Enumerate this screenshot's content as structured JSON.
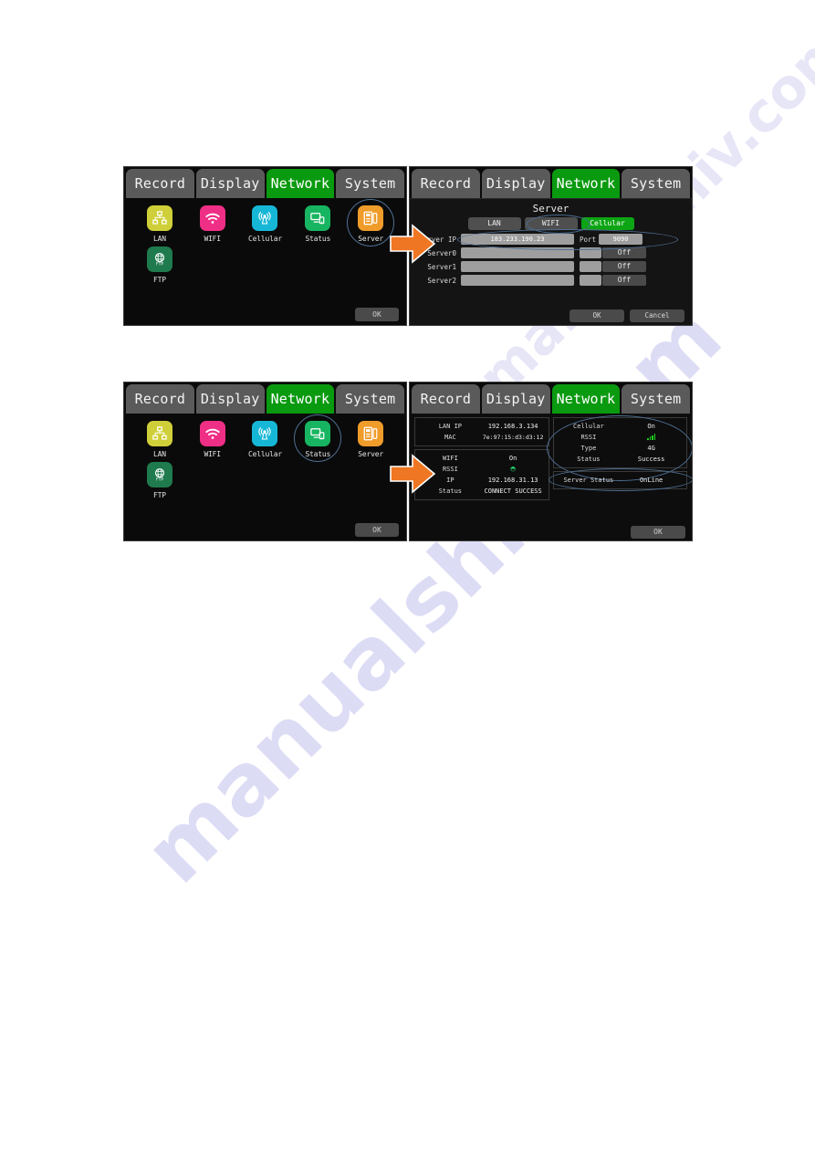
{
  "watermark": {
    "line1": "manualshiv",
    "line2": "manualshiv.com"
  },
  "tabs": [
    {
      "label": "Record",
      "active": false
    },
    {
      "label": "Display",
      "active": false
    },
    {
      "label": "Network",
      "active": true
    },
    {
      "label": "System",
      "active": false
    }
  ],
  "colors": {
    "active_tab": "#0a9a10",
    "highlight_ring": "#4d6f93",
    "arrow": "#ef7622",
    "lan_icon": "#cfcf3a",
    "wifi_icon": "#ef2f86",
    "cellular_icon": "#16b7d6",
    "status_icon": "#17b561",
    "server_icon": "#ef9c2a",
    "ftp_icon": "#1f7a4d",
    "signal_green": "#1fd21f"
  },
  "icon_menu": {
    "items": [
      {
        "label": "LAN",
        "icon": "lan-icon"
      },
      {
        "label": "WIFI",
        "icon": "wifi-icon"
      },
      {
        "label": "Cellular",
        "icon": "cellular-icon"
      },
      {
        "label": "Status",
        "icon": "status-icon"
      },
      {
        "label": "Server",
        "icon": "server-icon"
      },
      {
        "label": "FTP",
        "icon": "ftp-icon"
      }
    ],
    "ok_label": "OK",
    "panel1_selected": "Server",
    "panel2_selected": "Status"
  },
  "server_dialog": {
    "title": "Server",
    "subtabs": [
      {
        "label": "LAN",
        "active": false
      },
      {
        "label": "WIFI",
        "active": false
      },
      {
        "label": "Cellular",
        "active": true
      }
    ],
    "server_ip_label": "Server IP",
    "server_ip_value": "183.233.190.23",
    "port_label": "Port",
    "port_value": "9090",
    "rows": [
      {
        "label": "Server0",
        "value": "",
        "small": "",
        "state": "Off"
      },
      {
        "label": "Server1",
        "value": "",
        "small": "",
        "state": "Off"
      },
      {
        "label": "Server2",
        "value": "",
        "small": "",
        "state": "Off"
      }
    ],
    "ok_label": "OK",
    "cancel_label": "Cancel"
  },
  "status_panel": {
    "lan": [
      {
        "key": "LAN IP",
        "value": "192.168.3.134"
      },
      {
        "key": "MAC",
        "value": "7e:97:15:d3:d3:12"
      }
    ],
    "wifi": [
      {
        "key": "WIFI",
        "value": "On"
      },
      {
        "key": "RSSI",
        "value": "",
        "glyph": "wifi-signal-icon"
      },
      {
        "key": "IP",
        "value": "192.168.31.13"
      },
      {
        "key": "Status",
        "value": "CONNECT SUCCESS"
      }
    ],
    "cellular": [
      {
        "key": "Cellular",
        "value": "On"
      },
      {
        "key": "RSSI",
        "value": "",
        "glyph": "signal-bars-icon"
      },
      {
        "key": "Type",
        "value": "4G"
      },
      {
        "key": "Status",
        "value": "Success"
      }
    ],
    "server": [
      {
        "key": "Server Status",
        "value": "OnLine"
      }
    ],
    "ok_label": "OK"
  }
}
